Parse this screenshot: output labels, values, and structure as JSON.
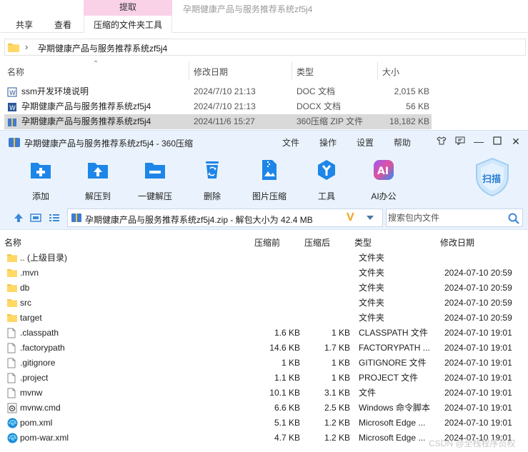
{
  "explorer": {
    "ribbon": {
      "context_header": "提取",
      "tabs": [
        "共享",
        "查看"
      ],
      "context_tab": "压缩的文件夹工具",
      "title": "孕期健康产品与服务推荐系统zf5j4"
    },
    "address": {
      "path": "孕期健康产品与服务推荐系统zf5j4"
    },
    "columns": [
      "名称",
      "修改日期",
      "类型",
      "大小"
    ],
    "files": [
      {
        "name": "ssm开发环境说明",
        "date": "2024/7/10 21:13",
        "type": "DOC 文档",
        "size": "2,015 KB",
        "icon": "word-doc-icon",
        "selected": false
      },
      {
        "name": "孕期健康产品与服务推荐系统zf5j4",
        "date": "2024/7/10 21:13",
        "type": "DOCX 文档",
        "size": "56 KB",
        "icon": "word-docx-icon",
        "selected": false
      },
      {
        "name": "孕期健康产品与服务推荐系统zf5j4",
        "date": "2024/11/6 15:27",
        "type": "360压缩 ZIP 文件",
        "size": "18,182 KB",
        "icon": "zip-archive-icon",
        "selected": true
      }
    ]
  },
  "zip": {
    "title": "孕期健康产品与服务推荐系统zf5j4 - 360压缩",
    "menu": [
      "文件",
      "操作",
      "设置",
      "帮助"
    ],
    "toolbar": [
      {
        "label": "添加",
        "icon": "add-icon"
      },
      {
        "label": "解压到",
        "icon": "extract-to-icon"
      },
      {
        "label": "一键解压",
        "icon": "one-click-extract-icon"
      },
      {
        "label": "删除",
        "icon": "delete-icon"
      },
      {
        "label": "图片压缩",
        "icon": "image-compress-icon"
      },
      {
        "label": "工具",
        "icon": "tools-icon"
      },
      {
        "label": "AI办公",
        "icon": "ai-office-icon"
      }
    ],
    "scan_label": "扫描",
    "path_text": "孕期健康产品与服务推荐系统zf5j4.zip - 解包大小为 42.4 MB",
    "search_placeholder": "搜索包内文件",
    "columns": [
      "名称",
      "压缩前",
      "压缩后",
      "类型",
      "修改日期"
    ],
    "rows": [
      {
        "name": ".. (上级目录)",
        "before": "",
        "after": "",
        "type": "文件夹",
        "date": "",
        "icon": "folder"
      },
      {
        "name": ".mvn",
        "before": "",
        "after": "",
        "type": "文件夹",
        "date": "2024-07-10 20:59",
        "icon": "folder"
      },
      {
        "name": "db",
        "before": "",
        "after": "",
        "type": "文件夹",
        "date": "2024-07-10 20:59",
        "icon": "folder"
      },
      {
        "name": "src",
        "before": "",
        "after": "",
        "type": "文件夹",
        "date": "2024-07-10 20:59",
        "icon": "folder"
      },
      {
        "name": "target",
        "before": "",
        "after": "",
        "type": "文件夹",
        "date": "2024-07-10 20:59",
        "icon": "folder"
      },
      {
        "name": ".classpath",
        "before": "1.6 KB",
        "after": "1 KB",
        "type": "CLASSPATH 文件",
        "date": "2024-07-10 19:01",
        "icon": "file"
      },
      {
        "name": ".factorypath",
        "before": "14.6 KB",
        "after": "1.7 KB",
        "type": "FACTORYPATH ...",
        "date": "2024-07-10 19:01",
        "icon": "file"
      },
      {
        "name": ".gitignore",
        "before": "1 KB",
        "after": "1 KB",
        "type": "GITIGNORE 文件",
        "date": "2024-07-10 19:01",
        "icon": "file"
      },
      {
        "name": ".project",
        "before": "1.1 KB",
        "after": "1 KB",
        "type": "PROJECT 文件",
        "date": "2024-07-10 19:01",
        "icon": "file"
      },
      {
        "name": "mvnw",
        "before": "10.1 KB",
        "after": "3.1 KB",
        "type": "文件",
        "date": "2024-07-10 19:01",
        "icon": "file"
      },
      {
        "name": "mvnw.cmd",
        "before": "6.6 KB",
        "after": "2.5 KB",
        "type": "Windows 命令脚本",
        "date": "2024-07-10 19:01",
        "icon": "cmd"
      },
      {
        "name": "pom.xml",
        "before": "5.1 KB",
        "after": "1.2 KB",
        "type": "Microsoft Edge ...",
        "date": "2024-07-10 19:01",
        "icon": "edge"
      },
      {
        "name": "pom-war.xml",
        "before": "4.7 KB",
        "after": "1.2 KB",
        "type": "Microsoft Edge ...",
        "date": "2024-07-10 19:01",
        "icon": "edge"
      }
    ]
  },
  "watermark": "CSDN @全栈程序员权"
}
